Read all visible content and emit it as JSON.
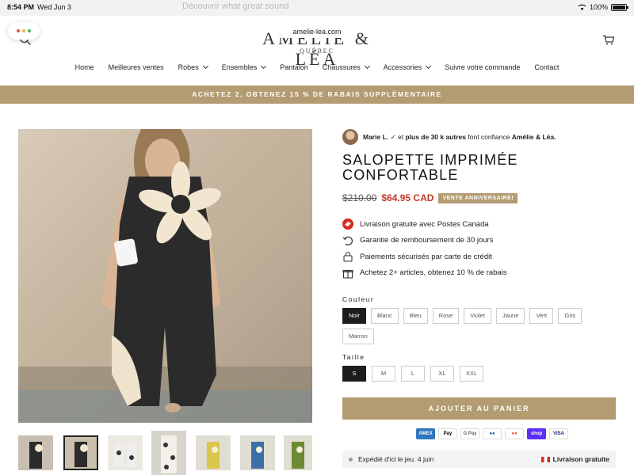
{
  "status_bar": {
    "time": "8:54 PM",
    "date": "Wed Jun 3",
    "battery": "100%"
  },
  "browser": {
    "url": "amelie-lea.com",
    "ghost_text": "Découvrir what great sound"
  },
  "header": {
    "logo": "AMÉLIE & LÉA",
    "logo_sub": "QUÉBEC",
    "nav": [
      {
        "label": "Home",
        "has_menu": false
      },
      {
        "label": "Meilleures ventes",
        "has_menu": false
      },
      {
        "label": "Robes",
        "has_menu": true
      },
      {
        "label": "Ensembles",
        "has_menu": true
      },
      {
        "label": "Pantalon",
        "has_menu": false
      },
      {
        "label": "Chaussures",
        "has_menu": true
      },
      {
        "label": "Accessories",
        "has_menu": true
      },
      {
        "label": "Suivre votre commande",
        "has_menu": false
      },
      {
        "label": "Contact",
        "has_menu": false
      }
    ]
  },
  "promo_banner": "ACHETEZ 2, OBTENEZ 15 % DE RABAIS SUPPLÉMENTAIRE",
  "trust": {
    "name": "Marie L.",
    "check": "✓",
    "middle": "et",
    "bold_count": "plus de 30 k autres",
    "rest": "font confiance",
    "brand": "Amélie & Léa."
  },
  "product": {
    "title": "SALOPETTE IMPRIMÉE CONFORTABLE",
    "old_price": "$210.00",
    "new_price": "$64.95 CAD",
    "badge": "VENTE ANNIVERSAIRE!",
    "benefits": [
      {
        "icon": "canada-post-icon",
        "text": "Livraison gratuite avec Postes Canada"
      },
      {
        "icon": "refund-icon",
        "text": "Garantie de remboursement de 30 jours"
      },
      {
        "icon": "lock-icon",
        "text": "Paiements sécurisés par carte de crédit"
      },
      {
        "icon": "gift-icon",
        "text": "Achetez 2+ articles, obtenez 10 % de rabais"
      }
    ],
    "color_label": "Couleur",
    "colors": [
      "Noir",
      "Blanc",
      "Bleu",
      "Rose",
      "Violet",
      "Jaune",
      "Vert",
      "Gris",
      "Marron"
    ],
    "selected_color": "Noir",
    "size_label": "Taille",
    "sizes": [
      "S",
      "M",
      "L",
      "XL",
      "XXL"
    ],
    "selected_size": "S",
    "add_to_cart": "AJOUTER AU PANIER",
    "payment_methods": [
      "AMEX",
      "Pay",
      "G Pay",
      "●●",
      "●●",
      "shop",
      "VISA"
    ],
    "shipping_note": "Expédié d'ici le jeu. 4 juin",
    "free_shipping": "Livraison gratuite"
  },
  "colors": {
    "accent": "#b39c72",
    "sale": "#c0392b",
    "selected": "#1d1d1d"
  }
}
